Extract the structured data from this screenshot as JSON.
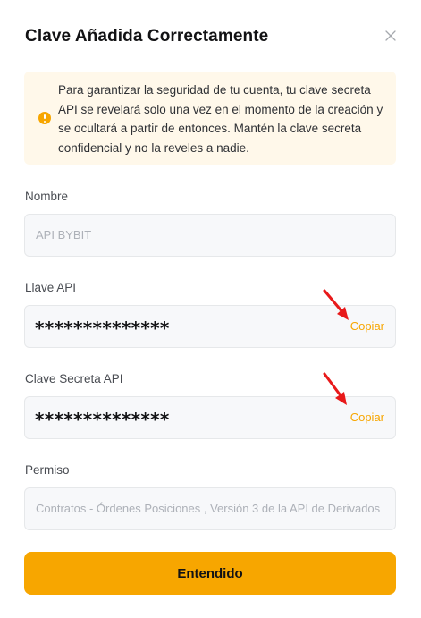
{
  "modal": {
    "title": "Clave Añadida Correctamente",
    "close_icon": "close-icon"
  },
  "notice": {
    "icon": "warning-icon",
    "text": "Para garantizar la seguridad de tu cuenta, tu clave secreta API se revelará solo una vez en el momento de la creación y se ocultará a partir de entonces. Mantén la clave secreta confidencial y no la reveles a nadie."
  },
  "fields": {
    "name": {
      "label": "Nombre",
      "value": "API BYBIT"
    },
    "api_key": {
      "label": "Llave API",
      "value": "**************",
      "copy_label": "Copiar"
    },
    "api_secret": {
      "label": "Clave Secreta API",
      "value": "**************",
      "copy_label": "Copiar"
    },
    "permission": {
      "label": "Permiso",
      "value": "Contratos - Órdenes Posiciones  , Versión 3 de la API de Derivados"
    }
  },
  "confirm_button": {
    "label": "Entendido"
  },
  "colors": {
    "accent": "#f7a600",
    "annotation_arrow": "#e8191a"
  }
}
